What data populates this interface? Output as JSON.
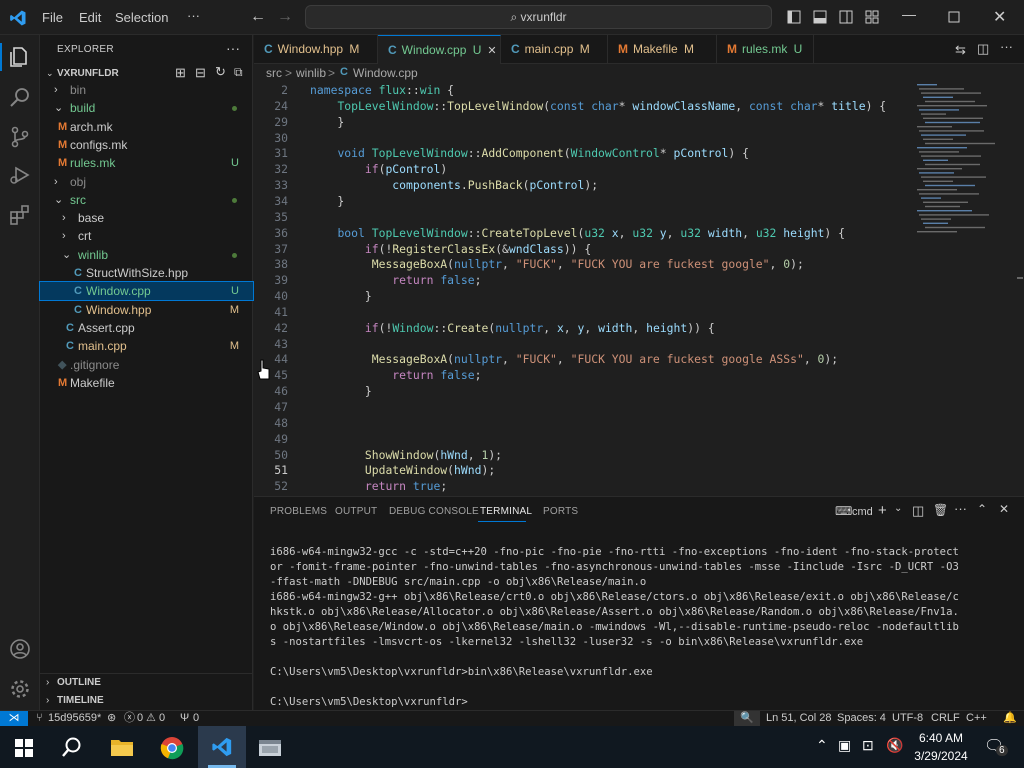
{
  "titlebar": {
    "menus": [
      "File",
      "Edit",
      "Selection",
      "···"
    ],
    "search": "vxrunfldr"
  },
  "explorer": {
    "header": "EXPLORER",
    "root": "VXRUNFLDR",
    "items": [
      {
        "label": "bin",
        "kind": "folder",
        "mark": ""
      },
      {
        "label": "build",
        "kind": "folder",
        "mark": "dot"
      },
      {
        "label": "arch.mk",
        "kind": "mk",
        "mark": ""
      },
      {
        "label": "configs.mk",
        "kind": "mk",
        "mark": ""
      },
      {
        "label": "rules.mk",
        "kind": "mk",
        "mark": "U"
      },
      {
        "label": "obj",
        "kind": "folder",
        "mark": ""
      },
      {
        "label": "src",
        "kind": "folder",
        "mark": "dot"
      },
      {
        "label": "base",
        "kind": "folder",
        "mark": ""
      },
      {
        "label": "crt",
        "kind": "folder",
        "mark": ""
      },
      {
        "label": "winlib",
        "kind": "folder",
        "mark": "dot"
      },
      {
        "label": "StructWithSize.hpp",
        "kind": "cpp",
        "mark": ""
      },
      {
        "label": "Window.cpp",
        "kind": "cpp",
        "mark": "U"
      },
      {
        "label": "Window.hpp",
        "kind": "cpp",
        "mark": "M"
      },
      {
        "label": "Assert.cpp",
        "kind": "cpp",
        "mark": ""
      },
      {
        "label": "main.cpp",
        "kind": "cpp",
        "mark": "M"
      },
      {
        "label": ".gitignore",
        "kind": "git",
        "mark": ""
      },
      {
        "label": "Makefile",
        "kind": "make",
        "mark": ""
      }
    ],
    "outline": "OUTLINE",
    "timeline": "TIMELINE"
  },
  "tabs": [
    {
      "label": "Window.hpp",
      "mark": "M",
      "icon": "C"
    },
    {
      "label": "Window.cpp",
      "mark": "U",
      "icon": "C",
      "active": true
    },
    {
      "label": "main.cpp",
      "mark": "M",
      "icon": "C"
    },
    {
      "label": "Makefile",
      "mark": "M",
      "icon": "M"
    },
    {
      "label": "rules.mk",
      "mark": "U",
      "icon": "M"
    }
  ],
  "breadcrumb": [
    "src",
    ">",
    "winlib",
    ">",
    "Window.cpp"
  ],
  "editor": {
    "lines": [
      {
        "n": "2",
        "html": "<span class='kw'>namespace</span> <span class='ty'>flux</span>::<span class='ty'>win</span> {"
      },
      {
        "n": "24",
        "html": "    <span class='ty'>TopLevelWindow</span>::<span class='fn'>TopLevelWindow</span>(<span class='kw'>const</span> <span class='kw'>char</span>* <span class='var'>windowClassName</span>, <span class='kw'>const</span> <span class='kw'>char</span>* <span class='var'>title</span>) {"
      },
      {
        "n": "29",
        "html": "    }"
      },
      {
        "n": "30",
        "html": ""
      },
      {
        "n": "31",
        "html": "    <span class='kw'>void</span> <span class='ty'>TopLevelWindow</span>::<span class='fn'>AddComponent</span>(<span class='ty'>WindowControl</span>* <span class='var'>pControl</span>) {"
      },
      {
        "n": "32",
        "html": "        <span class='ctl'>if</span>(<span class='var'>pControl</span>)"
      },
      {
        "n": "33",
        "html": "            <span class='var'>components</span>.<span class='fn'>PushBack</span>(<span class='var'>pControl</span>);"
      },
      {
        "n": "34",
        "html": "    }"
      },
      {
        "n": "35",
        "html": ""
      },
      {
        "n": "36",
        "html": "    <span class='kw'>bool</span> <span class='ty'>TopLevelWindow</span>::<span class='fn'>CreateTopLevel</span>(<span class='ty'>u32</span> <span class='var'>x</span>, <span class='ty'>u32</span> <span class='var'>y</span>, <span class='ty'>u32</span> <span class='var'>width</span>, <span class='ty'>u32</span> <span class='var'>height</span>) {"
      },
      {
        "n": "37",
        "html": "        <span class='ctl'>if</span>(!<span class='fn'>RegisterClassEx</span>(&amp;<span class='var'>wndClass</span>)) {"
      },
      {
        "n": "38",
        "html": "         <span class='fn'>MessageBoxA</span>(<span class='kw'>nullptr</span>, <span class='str'>\"FUCK\"</span>, <span class='str'>\"FUCK YOU are fuckest google\"</span>, <span class='num'>0</span>);"
      },
      {
        "n": "39",
        "html": "            <span class='ctl'>return</span> <span class='kw'>false</span>;"
      },
      {
        "n": "40",
        "html": "        }"
      },
      {
        "n": "41",
        "html": ""
      },
      {
        "n": "42",
        "html": "        <span class='ctl'>if</span>(!<span class='ty'>Window</span>::<span class='fn'>Create</span>(<span class='kw'>nullptr</span>, <span class='var'>x</span>, <span class='var'>y</span>, <span class='var'>width</span>, <span class='var'>height</span>)) {"
      },
      {
        "n": "43",
        "html": ""
      },
      {
        "n": "44",
        "html": "         <span class='fn'>MessageBoxA</span>(<span class='kw'>nullptr</span>, <span class='str'>\"FUCK\"</span>, <span class='str'>\"FUCK YOU are fuckest google ASSs\"</span>, <span class='num'>0</span>);"
      },
      {
        "n": "45",
        "html": "            <span class='ctl'>return</span> <span class='kw'>false</span>;"
      },
      {
        "n": "46",
        "html": "        }"
      },
      {
        "n": "47",
        "html": ""
      },
      {
        "n": "48",
        "html": ""
      },
      {
        "n": "49",
        "html": ""
      },
      {
        "n": "50",
        "html": "        <span class='fn'>ShowWindow</span>(<span class='var'>hWnd</span>, <span class='num'>1</span>);"
      },
      {
        "n": "51",
        "html": "        <span class='fn'>UpdateWindow</span>(<span class='var'>hWnd</span>);"
      },
      {
        "n": "52",
        "html": "        <span class='ctl'>return</span> <span class='kw'>true</span>;"
      }
    ]
  },
  "panel": {
    "tabs": [
      "PROBLEMS",
      "OUTPUT",
      "DEBUG CONSOLE",
      "TERMINAL",
      "PORTS"
    ],
    "active": "TERMINAL",
    "shell": "cmd",
    "terminal": "i686-w64-mingw32-gcc -c -std=c++20 -fno-pic -fno-pie -fno-rtti -fno-exceptions -fno-ident -fno-stack-protector -fomit-frame-pointer -fno-unwind-tables -fno-asynchronous-unwind-tables -msse -Iinclude -Isrc -D_UCRT -O3 -ffast-math -DNDEBUG src/main.cpp -o obj\\x86\\Release/main.o\ni686-w64-mingw32-g++ obj\\x86\\Release/crt0.o obj\\x86\\Release/ctors.o obj\\x86\\Release/exit.o obj\\x86\\Release/chkstk.o obj\\x86\\Release/Allocator.o obj\\x86\\Release/Assert.o obj\\x86\\Release/Random.o obj\\x86\\Release/Fnv1a.o obj\\x86\\Release/Window.o obj\\x86\\Release/main.o -mwindows -Wl,--disable-runtime-pseudo-reloc -nodefaultlibs -nostartfiles -lmsvcrt-os -lkernel32 -lshell32 -luser32 -s -o bin\\x86\\Release\\vxrunfldr.exe\n\nC:\\Users\\vm5\\Desktop\\vxrunfldr>bin\\x86\\Release\\vxrunfldr.exe\n\nC:\\Users\\vm5\\Desktop\\vxrunfldr>"
  },
  "status": {
    "branch": "15d95659*",
    "errors": "0",
    "warnings": "0",
    "ports": "0",
    "cursor": "Ln 51, Col 28",
    "spaces": "Spaces: 4",
    "encoding": "UTF-8",
    "eol": "CRLF",
    "lang": "C++"
  },
  "taskbar": {
    "time": "6:40 AM",
    "date": "3/29/2024",
    "notif": "6"
  },
  "colors": {
    "accent": "#0078d4",
    "modified": "#e2c08d",
    "untracked": "#73c991"
  }
}
